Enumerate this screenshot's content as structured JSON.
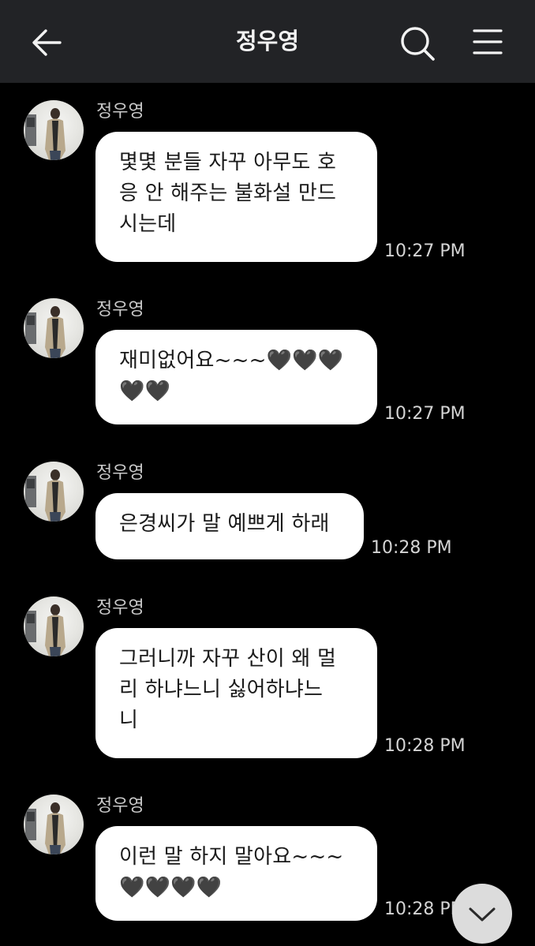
{
  "header": {
    "title": "정우영",
    "back_icon": "arrow-left-icon",
    "search_icon": "search-icon",
    "menu_icon": "hamburger-menu-icon"
  },
  "messages": [
    {
      "sender": "정우영",
      "text": "몇몇 분들  자꾸 아무도 호\n응 안 해주는 불화설 만드\n시는데",
      "time": "10:27 PM"
    },
    {
      "sender": "정우영",
      "text": "재미없어요~~~🖤🖤🖤\n🖤🖤",
      "time": "10:27 PM"
    },
    {
      "sender": "정우영",
      "text": "은경씨가 말 예쁘게 하래",
      "time": "10:28 PM"
    },
    {
      "sender": "정우영",
      "text": "그러니까 자꾸 산이 왜 멀\n리 하냐느니 싫어하냐느\n니",
      "time": "10:28 PM"
    },
    {
      "sender": "정우영",
      "text": "이런 말 하지 말아요~~~\n🖤🖤🖤🖤",
      "time": "10:28 PM"
    }
  ],
  "scroll_down_icon": "chevron-down-icon",
  "colors": {
    "header_bg": "#222326",
    "chat_bg": "#000000",
    "bubble_bg": "#ffffff",
    "time_text": "#d4d4d4"
  }
}
